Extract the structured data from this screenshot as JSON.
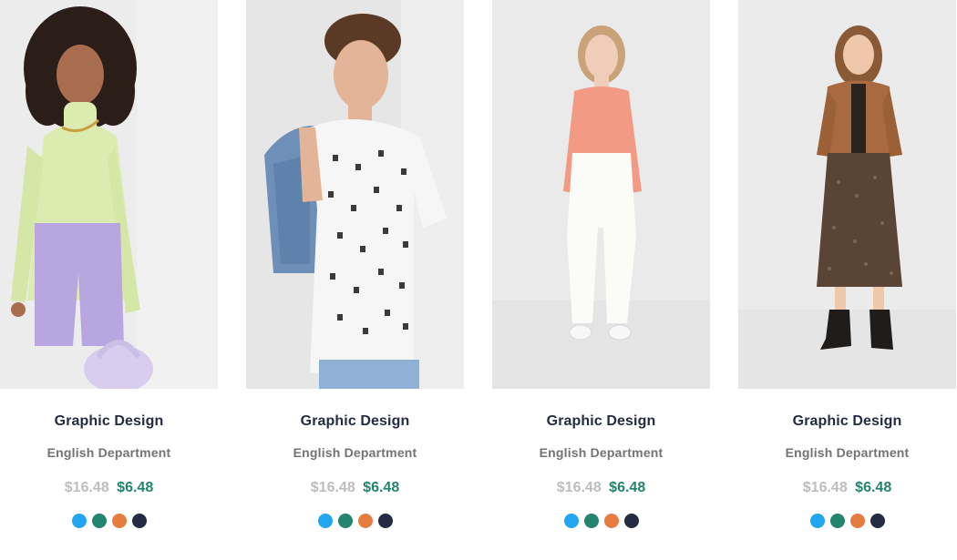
{
  "colors": {
    "title": "#252b42",
    "department": "#737373",
    "old_price": "#bdbdbd",
    "new_price": "#23856d"
  },
  "products": [
    {
      "image_icon": "model-photo-lime-turtleneck-lilac-shorts",
      "title": "Graphic Design",
      "department": "English Department",
      "old_price": "$16.48",
      "new_price": "$6.48",
      "swatches": [
        "#23a6f0",
        "#23856d",
        "#e77c40",
        "#252b42"
      ]
    },
    {
      "image_icon": "model-photo-letter-print-tee-denim-jacket",
      "title": "Graphic Design",
      "department": "English Department",
      "old_price": "$16.48",
      "new_price": "$6.48",
      "swatches": [
        "#23a6f0",
        "#23856d",
        "#e77c40",
        "#252b42"
      ]
    },
    {
      "image_icon": "model-photo-coral-top-white-jeans",
      "title": "Graphic Design",
      "department": "English Department",
      "old_price": "$16.48",
      "new_price": "$6.48",
      "swatches": [
        "#23a6f0",
        "#23856d",
        "#e77c40",
        "#252b42"
      ]
    },
    {
      "image_icon": "model-photo-suede-jacket-print-skirt",
      "title": "Graphic Design",
      "department": "English Department",
      "old_price": "$16.48",
      "new_price": "$6.48",
      "swatches": [
        "#23a6f0",
        "#23856d",
        "#e77c40",
        "#252b42"
      ]
    }
  ]
}
